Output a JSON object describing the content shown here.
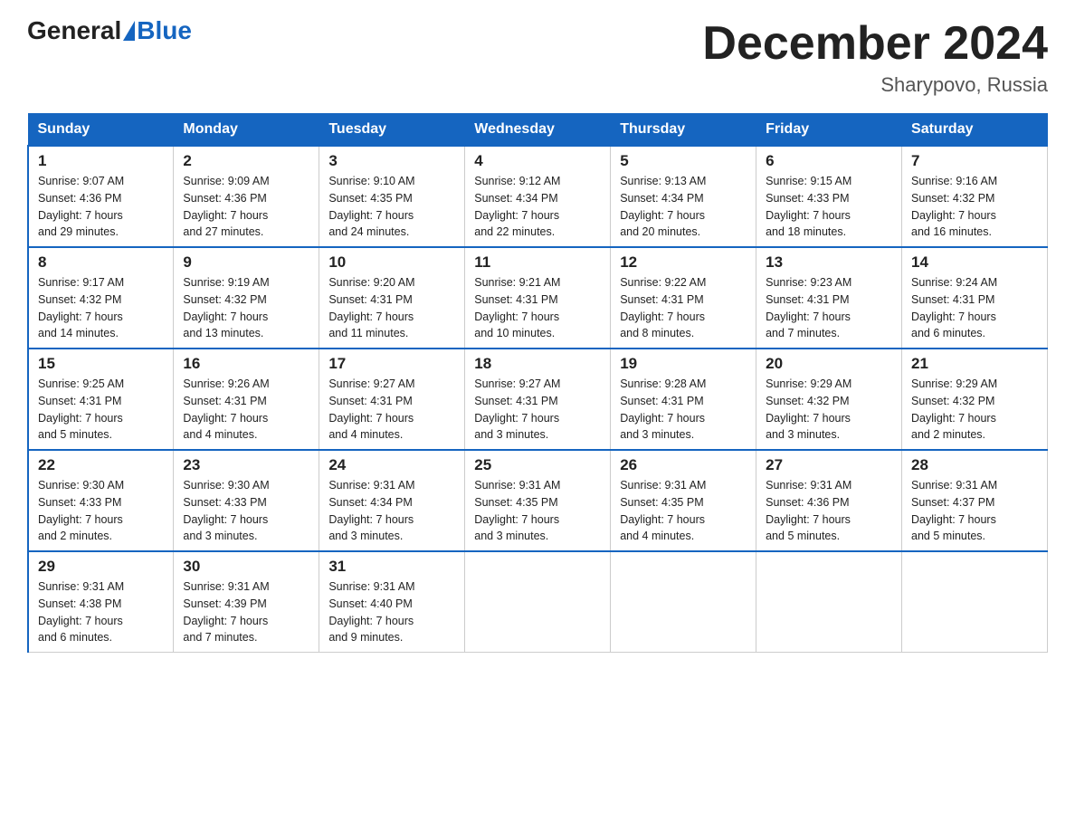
{
  "header": {
    "logo_general": "General",
    "logo_blue": "Blue",
    "month_title": "December 2024",
    "location": "Sharypovo, Russia"
  },
  "days_of_week": [
    "Sunday",
    "Monday",
    "Tuesday",
    "Wednesday",
    "Thursday",
    "Friday",
    "Saturday"
  ],
  "weeks": [
    [
      {
        "day": "1",
        "sunrise": "9:07 AM",
        "sunset": "4:36 PM",
        "daylight": "7 hours and 29 minutes."
      },
      {
        "day": "2",
        "sunrise": "9:09 AM",
        "sunset": "4:36 PM",
        "daylight": "7 hours and 27 minutes."
      },
      {
        "day": "3",
        "sunrise": "9:10 AM",
        "sunset": "4:35 PM",
        "daylight": "7 hours and 24 minutes."
      },
      {
        "day": "4",
        "sunrise": "9:12 AM",
        "sunset": "4:34 PM",
        "daylight": "7 hours and 22 minutes."
      },
      {
        "day": "5",
        "sunrise": "9:13 AM",
        "sunset": "4:34 PM",
        "daylight": "7 hours and 20 minutes."
      },
      {
        "day": "6",
        "sunrise": "9:15 AM",
        "sunset": "4:33 PM",
        "daylight": "7 hours and 18 minutes."
      },
      {
        "day": "7",
        "sunrise": "9:16 AM",
        "sunset": "4:32 PM",
        "daylight": "7 hours and 16 minutes."
      }
    ],
    [
      {
        "day": "8",
        "sunrise": "9:17 AM",
        "sunset": "4:32 PM",
        "daylight": "7 hours and 14 minutes."
      },
      {
        "day": "9",
        "sunrise": "9:19 AM",
        "sunset": "4:32 PM",
        "daylight": "7 hours and 13 minutes."
      },
      {
        "day": "10",
        "sunrise": "9:20 AM",
        "sunset": "4:31 PM",
        "daylight": "7 hours and 11 minutes."
      },
      {
        "day": "11",
        "sunrise": "9:21 AM",
        "sunset": "4:31 PM",
        "daylight": "7 hours and 10 minutes."
      },
      {
        "day": "12",
        "sunrise": "9:22 AM",
        "sunset": "4:31 PM",
        "daylight": "7 hours and 8 minutes."
      },
      {
        "day": "13",
        "sunrise": "9:23 AM",
        "sunset": "4:31 PM",
        "daylight": "7 hours and 7 minutes."
      },
      {
        "day": "14",
        "sunrise": "9:24 AM",
        "sunset": "4:31 PM",
        "daylight": "7 hours and 6 minutes."
      }
    ],
    [
      {
        "day": "15",
        "sunrise": "9:25 AM",
        "sunset": "4:31 PM",
        "daylight": "7 hours and 5 minutes."
      },
      {
        "day": "16",
        "sunrise": "9:26 AM",
        "sunset": "4:31 PM",
        "daylight": "7 hours and 4 minutes."
      },
      {
        "day": "17",
        "sunrise": "9:27 AM",
        "sunset": "4:31 PM",
        "daylight": "7 hours and 4 minutes."
      },
      {
        "day": "18",
        "sunrise": "9:27 AM",
        "sunset": "4:31 PM",
        "daylight": "7 hours and 3 minutes."
      },
      {
        "day": "19",
        "sunrise": "9:28 AM",
        "sunset": "4:31 PM",
        "daylight": "7 hours and 3 minutes."
      },
      {
        "day": "20",
        "sunrise": "9:29 AM",
        "sunset": "4:32 PM",
        "daylight": "7 hours and 3 minutes."
      },
      {
        "day": "21",
        "sunrise": "9:29 AM",
        "sunset": "4:32 PM",
        "daylight": "7 hours and 2 minutes."
      }
    ],
    [
      {
        "day": "22",
        "sunrise": "9:30 AM",
        "sunset": "4:33 PM",
        "daylight": "7 hours and 2 minutes."
      },
      {
        "day": "23",
        "sunrise": "9:30 AM",
        "sunset": "4:33 PM",
        "daylight": "7 hours and 3 minutes."
      },
      {
        "day": "24",
        "sunrise": "9:31 AM",
        "sunset": "4:34 PM",
        "daylight": "7 hours and 3 minutes."
      },
      {
        "day": "25",
        "sunrise": "9:31 AM",
        "sunset": "4:35 PM",
        "daylight": "7 hours and 3 minutes."
      },
      {
        "day": "26",
        "sunrise": "9:31 AM",
        "sunset": "4:35 PM",
        "daylight": "7 hours and 4 minutes."
      },
      {
        "day": "27",
        "sunrise": "9:31 AM",
        "sunset": "4:36 PM",
        "daylight": "7 hours and 5 minutes."
      },
      {
        "day": "28",
        "sunrise": "9:31 AM",
        "sunset": "4:37 PM",
        "daylight": "7 hours and 5 minutes."
      }
    ],
    [
      {
        "day": "29",
        "sunrise": "9:31 AM",
        "sunset": "4:38 PM",
        "daylight": "7 hours and 6 minutes."
      },
      {
        "day": "30",
        "sunrise": "9:31 AM",
        "sunset": "4:39 PM",
        "daylight": "7 hours and 7 minutes."
      },
      {
        "day": "31",
        "sunrise": "9:31 AM",
        "sunset": "4:40 PM",
        "daylight": "7 hours and 9 minutes."
      },
      null,
      null,
      null,
      null
    ]
  ],
  "labels": {
    "sunrise": "Sunrise:",
    "sunset": "Sunset:",
    "daylight": "Daylight:"
  }
}
